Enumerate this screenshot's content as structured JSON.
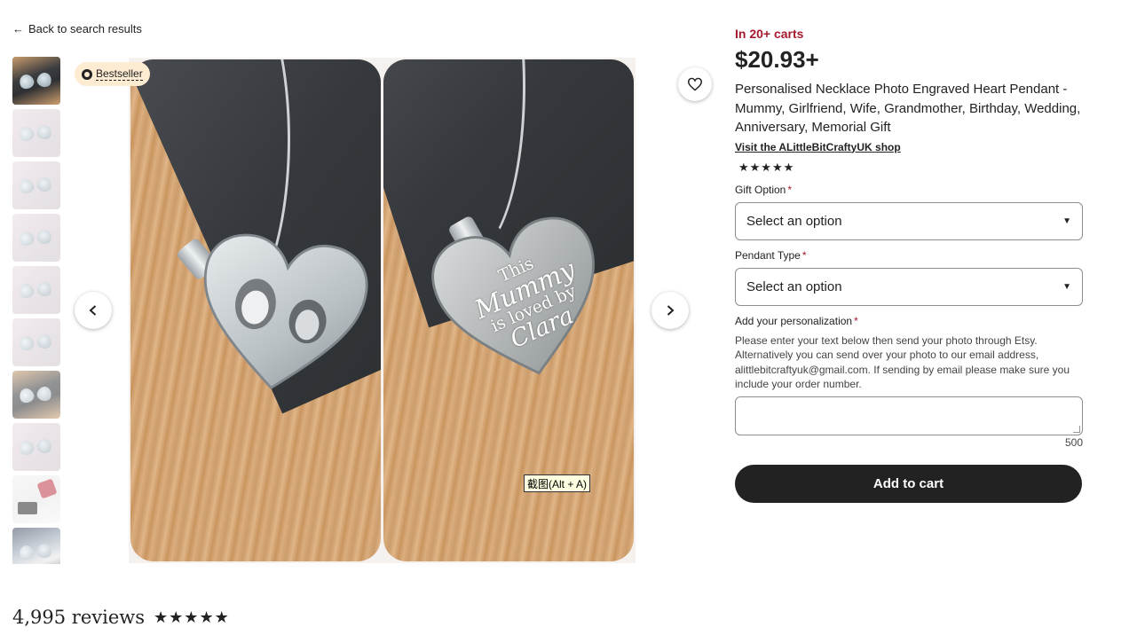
{
  "nav": {
    "back_label": "Back to search results",
    "back_icon": "arrow-left-icon"
  },
  "badge": {
    "label": "Bestseller"
  },
  "gallery": {
    "thumbnail_count": 10,
    "active_index": 0,
    "engraving": {
      "line1": "This",
      "line2": "Mummy",
      "line3": "is loved by",
      "line4": "Clara"
    }
  },
  "tooltip": {
    "text": "截图(Alt + A)"
  },
  "product": {
    "in_carts": "In 20+ carts",
    "price": "$20.93+",
    "title": "Personalised Necklace Photo Engraved Heart Pendant - Mummy, Girlfriend, Wife, Grandmother, Birthday, Wedding, Anniversary, Memorial Gift",
    "shop_link": "Visit the ALittleBitCraftyUK shop",
    "rating_stars": "★★★★★"
  },
  "options": {
    "gift": {
      "label": "Gift Option",
      "required": "*",
      "value": "Select an option"
    },
    "pendant": {
      "label": "Pendant Type",
      "required": "*",
      "value": "Select an option"
    }
  },
  "personalization": {
    "label": "Add your personalization",
    "required": "*",
    "help": "Please enter your text below then send your photo through Etsy. Alternatively you can send over your photo to our email address, alittlebitcraftyuk@gmail.com. If sending by email please make sure you include your order number.",
    "value": "",
    "char_limit": "500"
  },
  "cart": {
    "button_label": "Add to cart"
  },
  "reviews": {
    "count_label": "4,995 reviews",
    "stars": "★★★★★"
  },
  "colors": {
    "accent_red": "#a61a2e",
    "button_dark": "#222222",
    "badge_bg": "#fdebd2"
  }
}
